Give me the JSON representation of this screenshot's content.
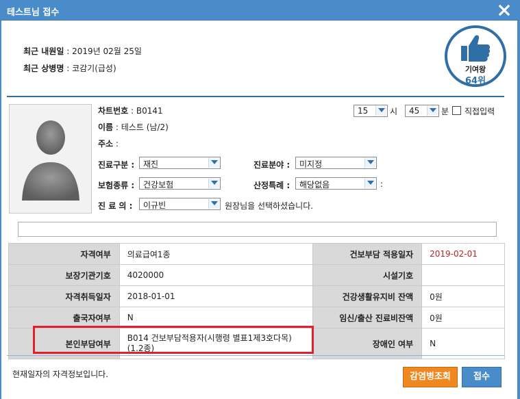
{
  "window": {
    "title": "테스트님 접수"
  },
  "visit": {
    "last_visit_label": "최근 내원일",
    "last_visit_value": ": 2019년 02월 25일",
    "last_disease_label": "최근 상병명",
    "last_disease_value": ": 코감기(급성)"
  },
  "badge": {
    "title": "기여왕",
    "rank": "64위",
    "icon": "thumbs-up-icon"
  },
  "patient": {
    "chart_label": "차트번호",
    "chart_value": ": B0141",
    "name_label": "이름",
    "name_value": ": 테스트 (남/2)",
    "address_label": "주소",
    "address_value": ":"
  },
  "time": {
    "hour": "15",
    "hour_unit": "시",
    "minute": "45",
    "minute_unit": "분",
    "manual_label": "직접입력"
  },
  "form": {
    "visit_type_label": "진료구분 :",
    "visit_type_value": "재진",
    "field_label": "진료분야 :",
    "field_value": "미지정",
    "insurance_label": "보험종류 :",
    "insurance_value": "건강보험",
    "exception_label": "산정특례 :",
    "exception_value": "해당없음",
    "exception_suffix": ":",
    "doctor_label": "진 료 의 :",
    "doctor_value": "이규빈",
    "doctor_note": "원장님을 선택하셨습니다."
  },
  "eligibility": {
    "rows": [
      {
        "h1": "자격여부",
        "v1": "의료급여1종",
        "h2": "건보부담 적용일자",
        "v2": "2019-02-01"
      },
      {
        "h1": "보장기관기호",
        "v1": "4020000",
        "h2": "시설기호",
        "v2": ""
      },
      {
        "h1": "자격취득일자",
        "v1": "2018-01-01",
        "h2": "건강생활유지비 잔액",
        "v2": "0원"
      },
      {
        "h1": "출국자여부",
        "v1": "N",
        "h2": "임신/출산 진료비잔액",
        "v2": "0원"
      },
      {
        "h1": "본인부담여부",
        "v1": "B014 건보부담적용자(시행령 별표1제3호다목)\n(1.2종)",
        "h2": "장애인 여부",
        "v2": "N"
      }
    ]
  },
  "status_text": "현재일자의 자격정보입니다.",
  "buttons": {
    "disease_lookup": "감염병조회",
    "register": "접수"
  },
  "colors": {
    "title_bar": "#4a8bc9",
    "accent_blue": "#2f6fa6",
    "highlight_red": "#e0202c",
    "orange": "#f0871f"
  }
}
